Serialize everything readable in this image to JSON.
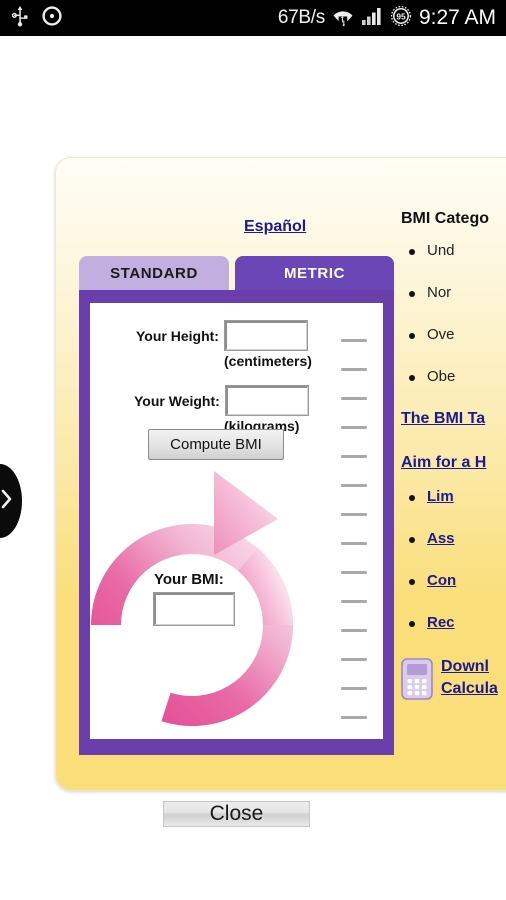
{
  "statusbar": {
    "icons": [
      "usb-icon",
      "circle-dot-icon",
      "wifi-icon",
      "signal-bars-icon",
      "battery-icon"
    ],
    "network_speed": "67B/s",
    "battery_level": "95",
    "clock": "9:27 AM"
  },
  "edge_tab": {
    "icon": "chevron-right-icon"
  },
  "dialog": {
    "language_link": "Español",
    "tabs": [
      {
        "label": "STANDARD",
        "active": false
      },
      {
        "label": "METRIC",
        "active": true
      }
    ],
    "form": {
      "height_label": "Your Height:",
      "height_value": "",
      "height_unit": "(centimeters)",
      "weight_label": "Your Weight:",
      "weight_value": "",
      "weight_unit": "(kilograms)",
      "compute_label": "Compute BMI",
      "bmi_label": "Your BMI:",
      "bmi_value": ""
    },
    "info": {
      "heading": "BMI Catego",
      "categories": [
        "Und",
        "Nor",
        "Ove",
        "Obe"
      ],
      "table_link": "The BMI Ta",
      "aim_link": "Aim for a H",
      "aim_items": [
        "Lim",
        "Ass",
        "Con",
        "Rec"
      ],
      "download_icon": "calculator-icon",
      "download_line1": "Downl",
      "download_line2": "Calcula"
    },
    "close_label": "Close"
  },
  "colors": {
    "tab_active": "#6a46b7",
    "tab_inactive": "#c3aee0",
    "frame": "#6a3fab",
    "page_yellow": "#fade7a",
    "link": "#1b1b8f",
    "accent_pink": "#e0559b"
  }
}
